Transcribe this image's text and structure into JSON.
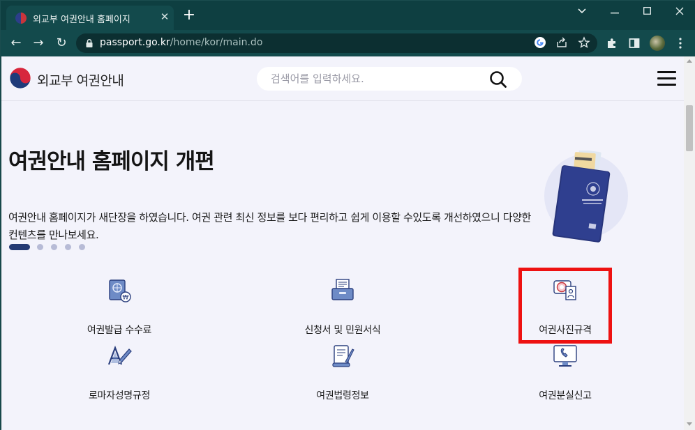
{
  "browser": {
    "tab": {
      "title": "외교부 여권안내 홈페이지",
      "close": "✕"
    },
    "new_tab": "+",
    "window": {
      "minimize": "—",
      "maximize": "☐",
      "close": "✕"
    },
    "nav": {
      "back": "←",
      "forward": "→",
      "reload": "↻"
    },
    "url": {
      "host": "passport.go.kr",
      "path": "/home/kor/main.do"
    }
  },
  "site": {
    "logo_text": "외교부 여권안내",
    "search_placeholder": "검색어를 입력하세요."
  },
  "hero": {
    "headline": "여권안내 홈페이지 개편",
    "description": "여권안내 홈페이지가 새단장을 하였습니다. 여권 관련 최신 정보를 보다 편리하고 쉽게 이용할 수있도록 개선하였으니 다양한 컨텐츠를 만나보세요.",
    "slide_count": 5,
    "active_slide": 1
  },
  "menu": {
    "items": [
      {
        "label": "여권발급 수수료",
        "icon": "passport-fee-icon"
      },
      {
        "label": "신청서 및 민원서식",
        "icon": "application-form-icon"
      },
      {
        "label": "여권사진규격",
        "icon": "passport-photo-icon"
      },
      {
        "label": "로마자성명규정",
        "icon": "romanization-icon"
      },
      {
        "label": "여권법령정보",
        "icon": "law-scroll-icon"
      },
      {
        "label": "여권분실신고",
        "icon": "lost-report-icon"
      }
    ]
  },
  "colors": {
    "browser_chrome": "#134a4c",
    "page_bg": "#f3f3fb",
    "accent_navy": "#243a73",
    "highlight_red": "#ee1111"
  }
}
